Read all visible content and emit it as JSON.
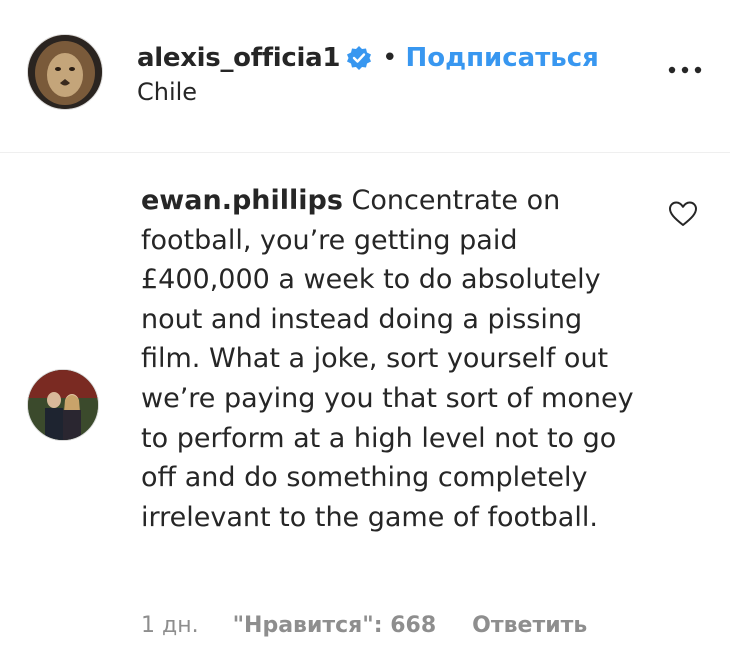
{
  "post_header": {
    "username": "alexis_officia1",
    "separator": "•",
    "follow_label": "Подписаться",
    "location": "Chile",
    "avatar_icon": "lion-avatar",
    "verified_icon": "verified-badge-icon",
    "more_icon": "more-options-icon"
  },
  "comment": {
    "username": "ewan.phillips",
    "text": " Concentrate on football, you’re getting paid £400,000 a week to do absolutely nout and instead doing a pissing film. What a joke, sort yourself out we’re paying you that sort of money to perform at a high level not to go off and do something completely irrelevant to the game of football.",
    "time": "1 дн.",
    "likes_label": "\"Нравится\": 668",
    "reply_label": "Ответить",
    "like_icon": "heart-outline-icon"
  },
  "colors": {
    "link_blue": "#3897f0",
    "text": "#262626",
    "muted": "#8e8e8e",
    "divider": "#efefef"
  }
}
